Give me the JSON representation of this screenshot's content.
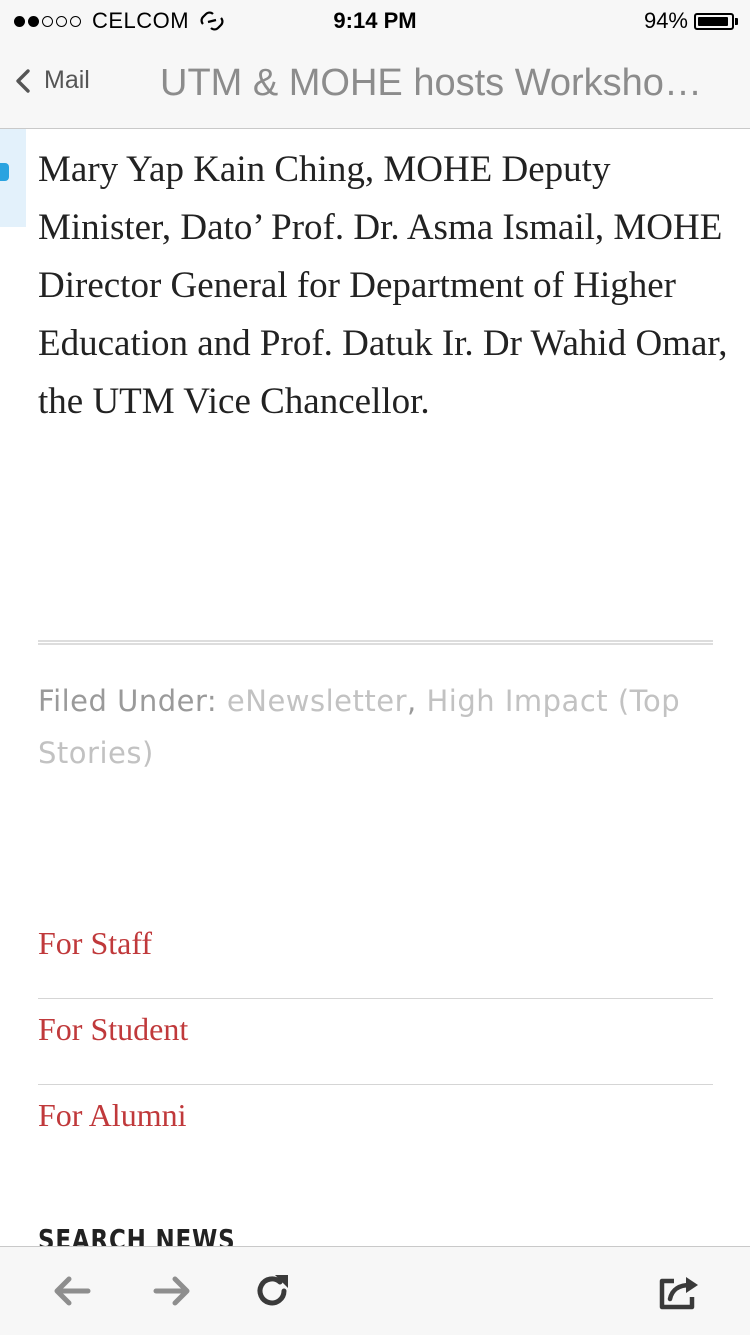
{
  "status_bar": {
    "signal_bars_filled": 2,
    "signal_bars_total": 5,
    "carrier": "CELCOM",
    "time": "9:14 PM",
    "battery_percent_label": "94%",
    "battery_level": 0.94
  },
  "nav": {
    "back_label": "Mail",
    "title": "UTM & MOHE hosts Worksho…"
  },
  "article": {
    "text": "Mary Yap Kain Ching, MOHE Deputy Minister, Dato’ Prof. Dr. Asma Ismail, MOHE Director General for Department of Higher Education and Prof. Datuk Ir. Dr Wahid Omar, the UTM Vice Chancellor."
  },
  "filed": {
    "label": "Filed Under:",
    "categories": [
      "eNewsletter",
      "High Impact (Top Stories)"
    ],
    "separator": ","
  },
  "menu": {
    "items": [
      {
        "label": "For Staff"
      },
      {
        "label": "For Student"
      },
      {
        "label": "For Alumni"
      }
    ]
  },
  "search": {
    "heading": "SEARCH NEWS"
  },
  "toolbar": {
    "icons": [
      "back-arrow-icon",
      "forward-arrow-icon",
      "reload-icon",
      "share-icon"
    ]
  },
  "colors": {
    "link_red": "#c0393b",
    "muted_gray": "#9a9a9a",
    "side_tab_blue": "#2aa3e0"
  }
}
